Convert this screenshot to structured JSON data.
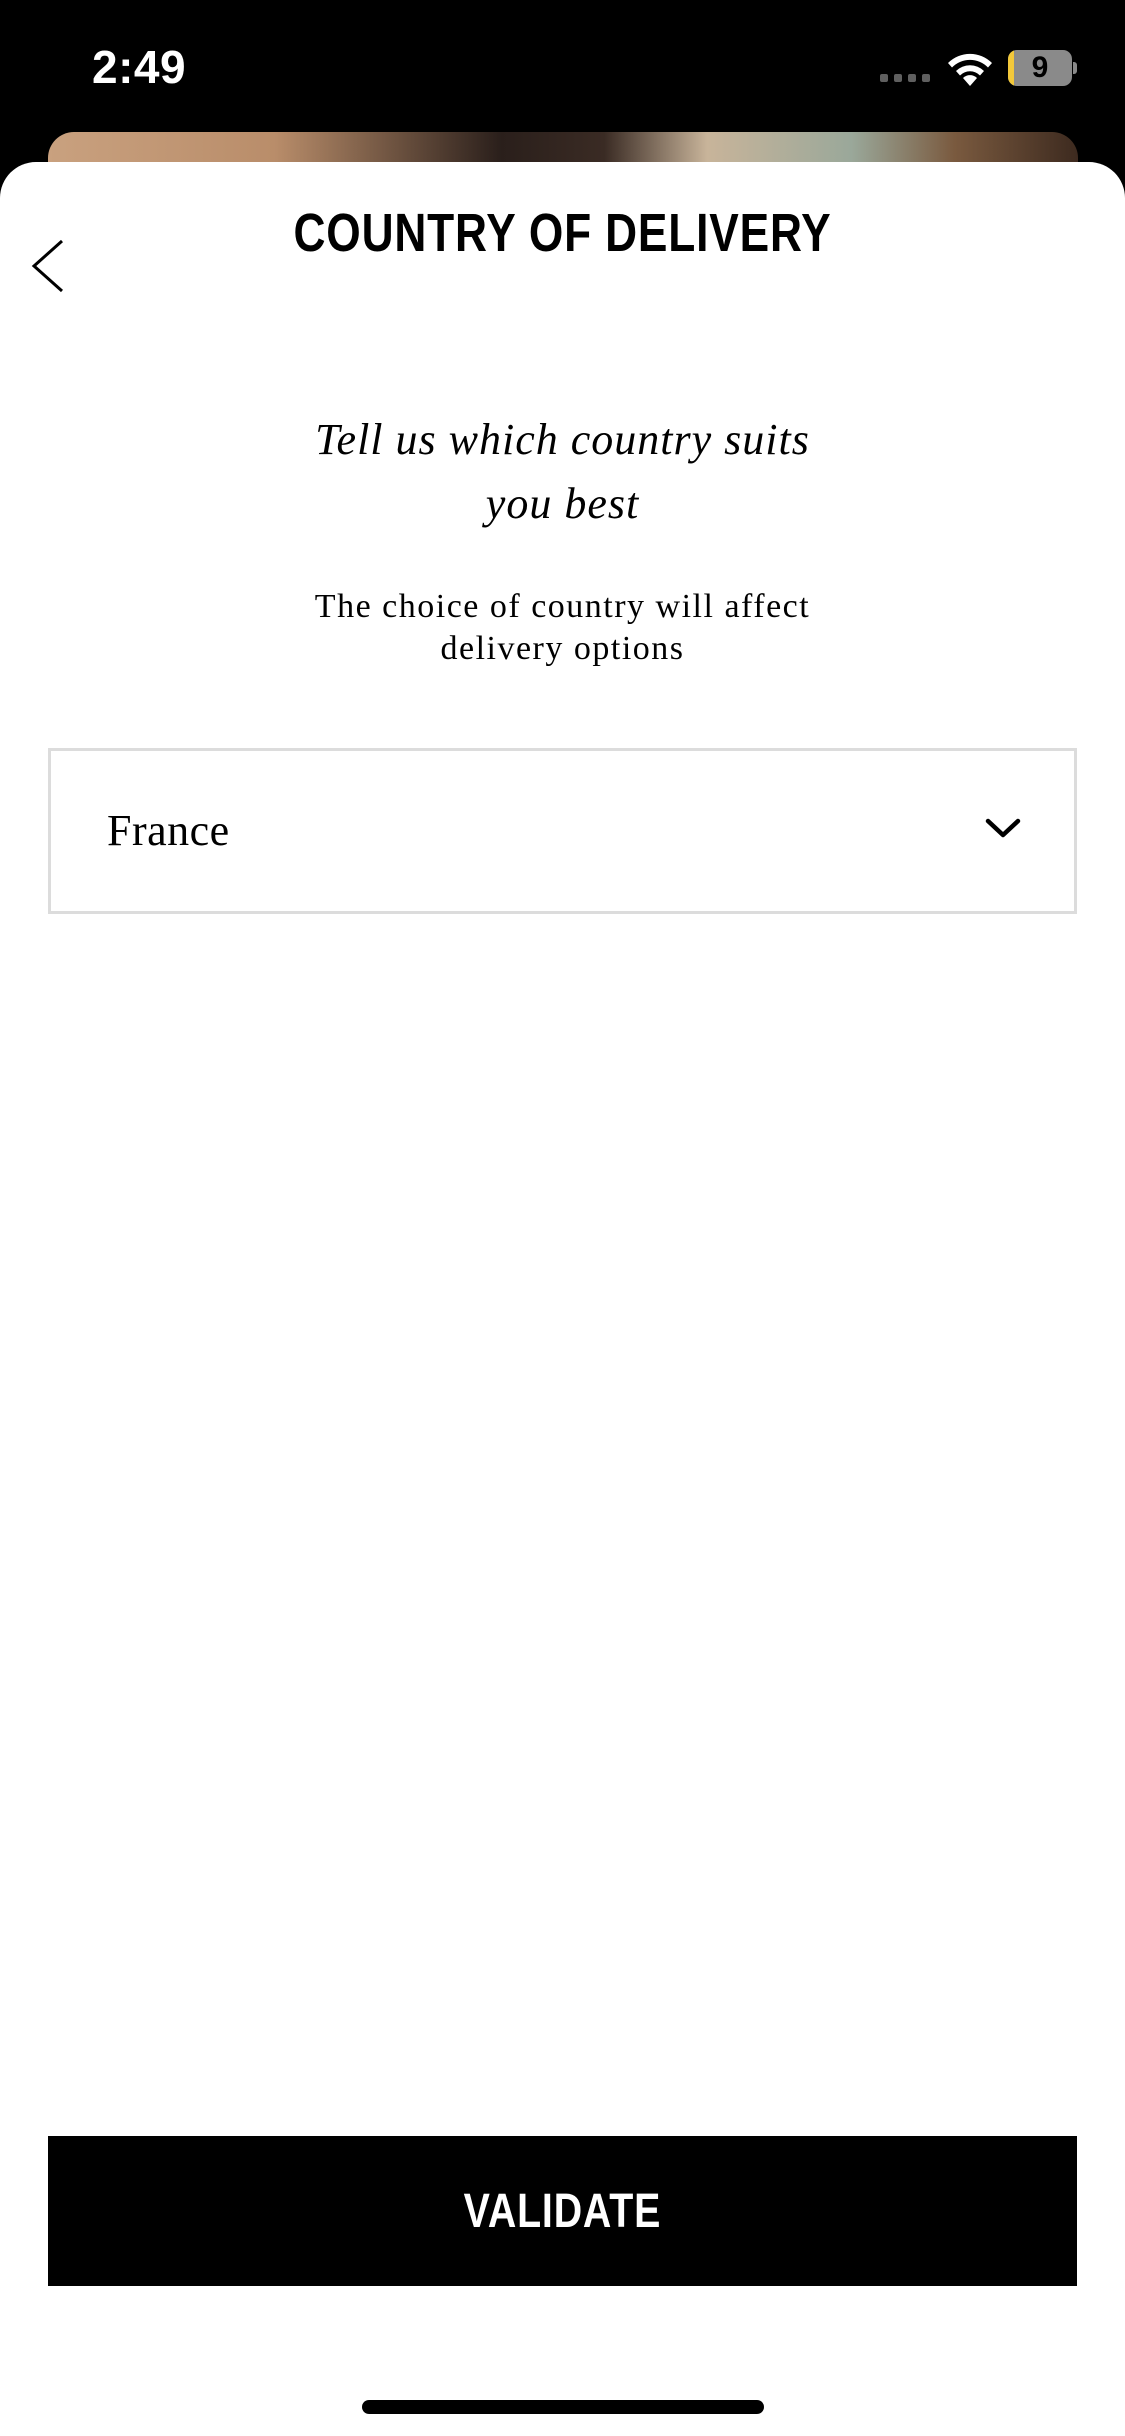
{
  "status_bar": {
    "time": "2:49",
    "battery_level": "9",
    "battery_fraction": 0.09,
    "battery_fill_color": "#f2c83a",
    "icons": [
      "cellular-signal-icon",
      "wifi-icon",
      "battery-icon"
    ]
  },
  "header": {
    "title": "COUNTRY OF DELIVERY",
    "back_icon": "chevron-left-icon"
  },
  "content": {
    "tagline_lines": [
      "Tell us which country suits",
      "you best"
    ],
    "info_lines": [
      "The choice of country will affect",
      "delivery options"
    ]
  },
  "country_select": {
    "selected_value": "France",
    "icon": "chevron-down-icon"
  },
  "footer": {
    "validate_label": "VALIDATE"
  },
  "colors": {
    "background": "#ffffff",
    "primary": "#000000",
    "button_text": "#ffffff",
    "select_border": "#dcdcdc"
  }
}
